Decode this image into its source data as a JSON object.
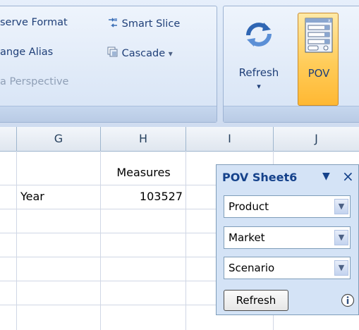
{
  "ribbon": {
    "preserve_format": "serve Format",
    "change_alias": "ange Alias",
    "smart_slice": "Smart Slice",
    "cascade": "Cascade",
    "cascade_arrow": "▾",
    "data_perspective": "a Perspective",
    "refresh_label": "Refresh",
    "refresh_arrow": "▾",
    "pov_label": "POV"
  },
  "sheet": {
    "columns": [
      "G",
      "H",
      "I",
      "J"
    ],
    "rows": [
      {
        "G": "",
        "H": "Measures"
      },
      {
        "G": "Year",
        "H": "103527"
      }
    ]
  },
  "pov_panel": {
    "title": "POV Sheet6",
    "menu_arrow": "▼",
    "close": "×",
    "selects": [
      "Product",
      "Market",
      "Scenario"
    ],
    "refresh_button": "Refresh"
  },
  "colors": {
    "pov_highlight": "#ffcc59",
    "ribbon_bg": "#d7e4f5",
    "panel_bg": "#d4e3f6"
  }
}
